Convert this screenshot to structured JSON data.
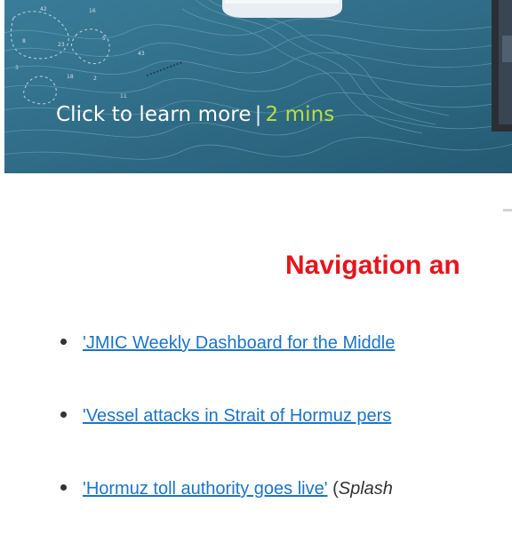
{
  "banner": {
    "cta_text": "Click to learn more",
    "separator": "|",
    "duration": "2 mins",
    "colors": {
      "sea": "#2f6c86",
      "sea_light": "#3f86a0",
      "contour": "#7fb2c4",
      "cta_text": "#ffffff",
      "duration_text": "#b9dd44"
    }
  },
  "section": {
    "title": "Navigation an",
    "title_color": "#e8141b"
  },
  "news": [
    {
      "link_text": "'JMIC Weekly Dashboard for the Middle",
      "open_paren": "",
      "source": "",
      "close_paren": ""
    },
    {
      "link_text": "'Vessel attacks in Strait of Hormuz pers",
      "open_paren": "",
      "source": "",
      "close_paren": ""
    },
    {
      "link_text": "'Hormuz toll authority goes live'",
      "open_paren": " (",
      "source": "Splash",
      "close_paren": ""
    }
  ],
  "link_color": "#1c74c9"
}
